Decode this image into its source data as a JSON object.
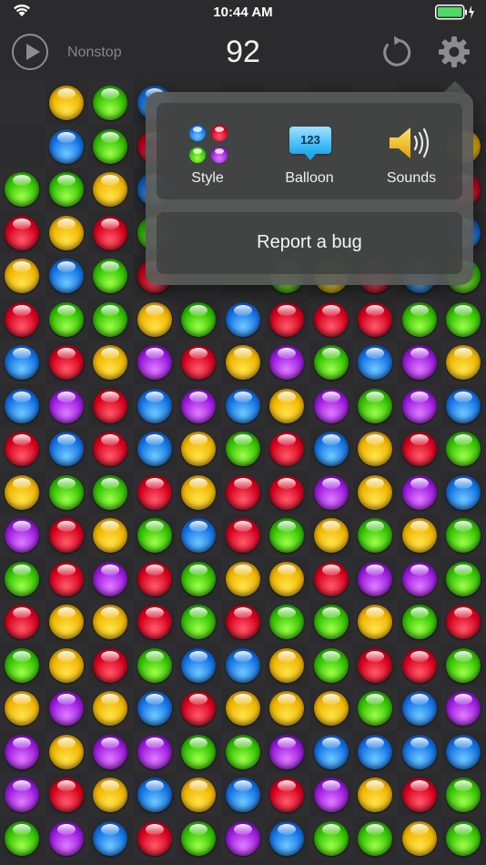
{
  "status_bar": {
    "time": "10:44 AM"
  },
  "header": {
    "mode_label": "Nonstop",
    "score": "92"
  },
  "popup": {
    "options": [
      {
        "label": "Style",
        "icon": "style-icon"
      },
      {
        "label": "Balloon",
        "icon": "balloon-icon",
        "icon_text": "123"
      },
      {
        "label": "Sounds",
        "icon": "speaker-icon"
      }
    ],
    "report_label": "Report a bug"
  },
  "colors": {
    "background": "#2b2b2d",
    "yellow": "#f0b600",
    "green": "#33c200",
    "red": "#d9001e",
    "blue": "#1474e6",
    "purple": "#9d1be0"
  },
  "board": {
    "columns": 11,
    "rows": [
      [
        "empty",
        "yellow",
        "green",
        "blue",
        "empty",
        "empty",
        "empty",
        "empty",
        "empty",
        "empty",
        "empty"
      ],
      [
        "empty",
        "blue",
        "green",
        "red",
        "empty",
        "empty",
        "empty",
        "empty",
        "empty",
        "empty",
        "yellow"
      ],
      [
        "green",
        "green",
        "yellow",
        "blue",
        "empty",
        "empty",
        "empty",
        "empty",
        "empty",
        "empty",
        "red"
      ],
      [
        "red",
        "yellow",
        "red",
        "green",
        "empty",
        "empty",
        "empty",
        "empty",
        "empty",
        "empty",
        "blue"
      ],
      [
        "yellow",
        "blue",
        "green",
        "red",
        "empty",
        "empty",
        "green",
        "yellow",
        "red",
        "blue",
        "green"
      ],
      [
        "red",
        "green",
        "green",
        "yellow",
        "green",
        "blue",
        "red",
        "red",
        "red",
        "green",
        "green"
      ],
      [
        "blue",
        "red",
        "yellow",
        "purple",
        "red",
        "yellow",
        "purple",
        "green",
        "blue",
        "purple",
        "yellow"
      ],
      [
        "blue",
        "purple",
        "red",
        "blue",
        "purple",
        "blue",
        "yellow",
        "purple",
        "green",
        "purple",
        "blue"
      ],
      [
        "red",
        "blue",
        "red",
        "blue",
        "yellow",
        "green",
        "red",
        "blue",
        "yellow",
        "red",
        "green"
      ],
      [
        "yellow",
        "green",
        "green",
        "red",
        "yellow",
        "red",
        "red",
        "purple",
        "yellow",
        "purple",
        "blue"
      ],
      [
        "purple",
        "red",
        "yellow",
        "green",
        "blue",
        "red",
        "green",
        "yellow",
        "green",
        "yellow",
        "green"
      ],
      [
        "green",
        "red",
        "purple",
        "red",
        "green",
        "yellow",
        "yellow",
        "red",
        "purple",
        "purple",
        "green"
      ],
      [
        "red",
        "yellow",
        "yellow",
        "red",
        "green",
        "red",
        "green",
        "green",
        "yellow",
        "green",
        "red"
      ],
      [
        "green",
        "yellow",
        "red",
        "green",
        "blue",
        "blue",
        "yellow",
        "green",
        "red",
        "red",
        "green"
      ],
      [
        "yellow",
        "purple",
        "yellow",
        "blue",
        "red",
        "yellow",
        "yellow",
        "yellow",
        "green",
        "blue",
        "purple"
      ],
      [
        "purple",
        "yellow",
        "purple",
        "purple",
        "green",
        "green",
        "purple",
        "blue",
        "blue",
        "blue",
        "blue"
      ],
      [
        "purple",
        "red",
        "yellow",
        "blue",
        "yellow",
        "blue",
        "red",
        "purple",
        "yellow",
        "red",
        "green"
      ],
      [
        "green",
        "purple",
        "blue",
        "red",
        "green",
        "purple",
        "blue",
        "green",
        "green",
        "yellow",
        "green"
      ]
    ]
  }
}
